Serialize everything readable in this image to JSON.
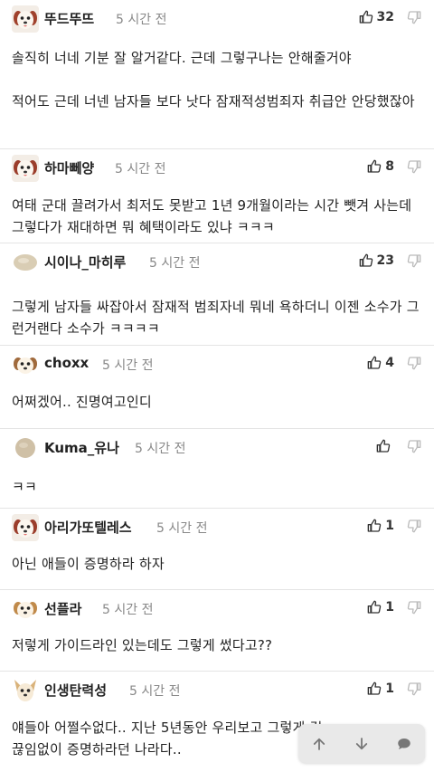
{
  "comments": [
    {
      "username": "뚜드뚜뜨",
      "time": "5 시간 전",
      "likes": "32",
      "avatar": "puppy-icon",
      "body": "솔직히 너네 기분 잘 알거같다. 근데 그렇구나는 안해줄거야\n\n적어도 근데 너넨 남자들 보다 낫다 잠재적성범죄자 취급안 안당했잖아"
    },
    {
      "username": "하마뻬양",
      "time": "5 시간 전",
      "likes": "8",
      "avatar": "puppy-icon",
      "body": "여태 군대 끌려가서 최저도 못받고 1년 9개월이라는 시간 뺏겨 사는데 그렇다가 재대하면 뭐 혜택이라도 있냐 ㅋㅋㅋ"
    },
    {
      "username": "시이나_마히루",
      "time": "5 시간 전",
      "likes": "23",
      "avatar": "round-face-icon",
      "body": "그렇게 남자들 싸잡아서 잠재적 범죄자네 뭐네 욕하더니 이젠 소수가 그런거랜다 소수가 ㅋㅋㅋㅋ"
    },
    {
      "username": "choxx",
      "time": "5 시간 전",
      "likes": "4",
      "avatar": "puppy-icon",
      "body": "어쩌겠어.. 진명여고인디"
    },
    {
      "username": "Kuma_유나",
      "time": "5 시간 전",
      "likes": "",
      "avatar": "round-face-icon",
      "body": "ㅋㅋ"
    },
    {
      "username": "아리가또텔레스",
      "time": "5 시간 전",
      "likes": "1",
      "avatar": "puppy-icon",
      "body": "아닌 애들이 증명하라 하자"
    },
    {
      "username": "선플라",
      "time": "5 시간 전",
      "likes": "1",
      "avatar": "puppy-icon",
      "body": "저렇게 가이드라인 있는데도 그렇게 썼다고??"
    },
    {
      "username": "인생탄력성",
      "time": "5 시간 전",
      "likes": "1",
      "avatar": "chihuahua-icon",
      "body": "얘들아 어쩔수없다.. 지난 5년동안 우리보고 그렇게 걸\n끊임없이 증명하라던 나라다.."
    }
  ],
  "toolbar": {
    "up": "arrow-up-icon",
    "down": "arrow-down-icon",
    "comment": "comment-icon"
  }
}
